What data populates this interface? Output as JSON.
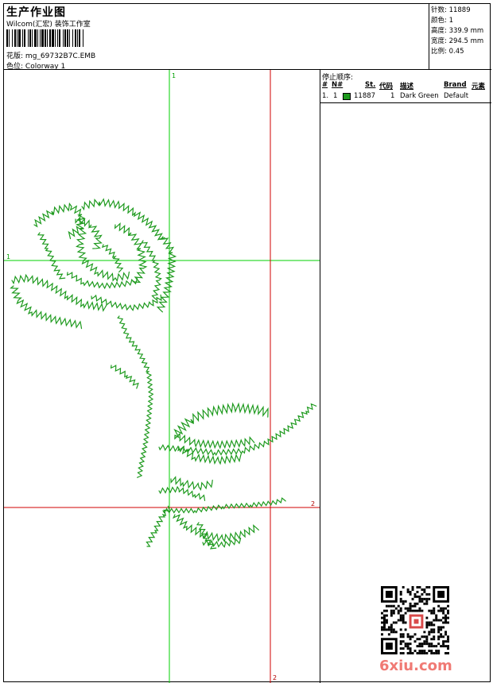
{
  "header": {
    "title": "生产作业图",
    "company": "Wilcom(汇宏) 装饰工作室",
    "design_label": "花版:",
    "design_value": "mg_69732B7C.EMB",
    "colorway_label": "色位:",
    "colorway_value": "Colorway 1"
  },
  "stats": [
    {
      "label": "针数:",
      "value": "11889"
    },
    {
      "label": "颜色:",
      "value": "1"
    },
    {
      "label": "高度:",
      "value": "339.9 mm"
    },
    {
      "label": "宽度:",
      "value": "294.5 mm"
    },
    {
      "label": "比例:",
      "value": "0.45"
    }
  ],
  "crosshair_labels": {
    "top_green": "1",
    "left_green": "1",
    "right_red": "2",
    "bottom_red": "2"
  },
  "stop_sequence": {
    "title": "停止顺序:",
    "columns": [
      "#",
      "N#",
      "St.",
      "代码",
      "描述",
      "Brand",
      "元素"
    ],
    "rows": [
      {
        "index": "1.",
        "needle": "1",
        "color": "#1e9a1e",
        "stitches": "11887",
        "code": "1",
        "description": "Dark Green",
        "brand": "Default",
        "element": ""
      }
    ]
  },
  "watermark": {
    "text": "6xiu.com",
    "color": "#f07a74"
  },
  "colors": {
    "thread": "#1e9a1e",
    "guide_green": "#00d000",
    "guide_red": "#d00000"
  }
}
